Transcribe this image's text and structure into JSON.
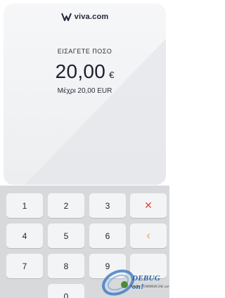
{
  "brand": {
    "name": "viva.com",
    "logo": "viva-logo-icon"
  },
  "prompt": "ΕΙΣΑΓΕΤΕ ΠΟΣΟ",
  "amount": {
    "value": "20,00",
    "currency_symbol": "€"
  },
  "limit_text": "Μέχρι 20,00 EUR",
  "keypad": {
    "keys": [
      {
        "label": "1"
      },
      {
        "label": "2"
      },
      {
        "label": "3"
      },
      {
        "label": "✕",
        "icon": "clear-icon",
        "color": "#e1453a"
      },
      {
        "label": "4"
      },
      {
        "label": "5"
      },
      {
        "label": "6"
      },
      {
        "label": "‹",
        "icon": "backspace-icon",
        "color": "#efa03a"
      },
      {
        "label": "7"
      },
      {
        "label": "8"
      },
      {
        "label": "9"
      },
      {
        "label": "0"
      }
    ]
  },
  "watermark": {
    "title": "DEBUG on!",
    "subtitle": "Not for COMMERCIAL use",
    "icon": "debug-watermark-icon"
  },
  "colors": {
    "background": "#ffffff",
    "card": "#eceef0",
    "keypad": "#d7d9db",
    "clear": "#e1453a",
    "backspace": "#efa03a"
  }
}
